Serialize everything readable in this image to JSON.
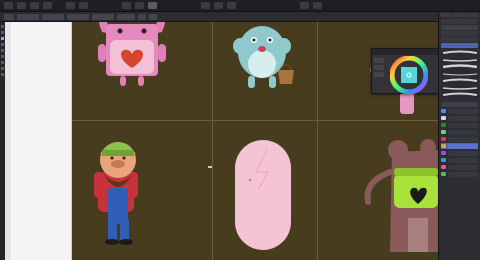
{
  "app": {
    "accent_color": "#5e7eff",
    "tool_icons": [
      "move-tool-icon",
      "select-tool-icon",
      "brush-tool-icon",
      "eraser-tool-icon",
      "fill-tool-icon",
      "pen-tool-icon",
      "shape-tool-icon",
      "text-tool-icon",
      "zoom-tool-icon"
    ]
  },
  "topbar": {
    "persona_icons": [
      "photo-persona-icon",
      "liquify-persona-icon",
      "develop-persona-icon"
    ]
  },
  "canvas": {
    "artboard_color": "#483c1e",
    "characters": [
      {
        "name": "pink-bunny-jar"
      },
      {
        "name": "blue-monster-with-basket"
      },
      {
        "name": "pink-mushroom"
      },
      {
        "name": "bearded-lumberjack"
      },
      {
        "name": "pink-capsule-sketch"
      },
      {
        "name": "bear-with-green-heart-jar"
      }
    ]
  },
  "color_panel": {
    "selected_color": "#1ec8c8"
  },
  "right_panel": {
    "swatches": [
      "#4d8be6",
      "#d6d6d6",
      "#2c8a2c",
      "#6dd36d",
      "#d64040",
      "#e0a03a",
      "#a14ad6",
      "#2a9ed1",
      "#e05a9a",
      "#3fbf6f"
    ],
    "brush_count": 11
  }
}
